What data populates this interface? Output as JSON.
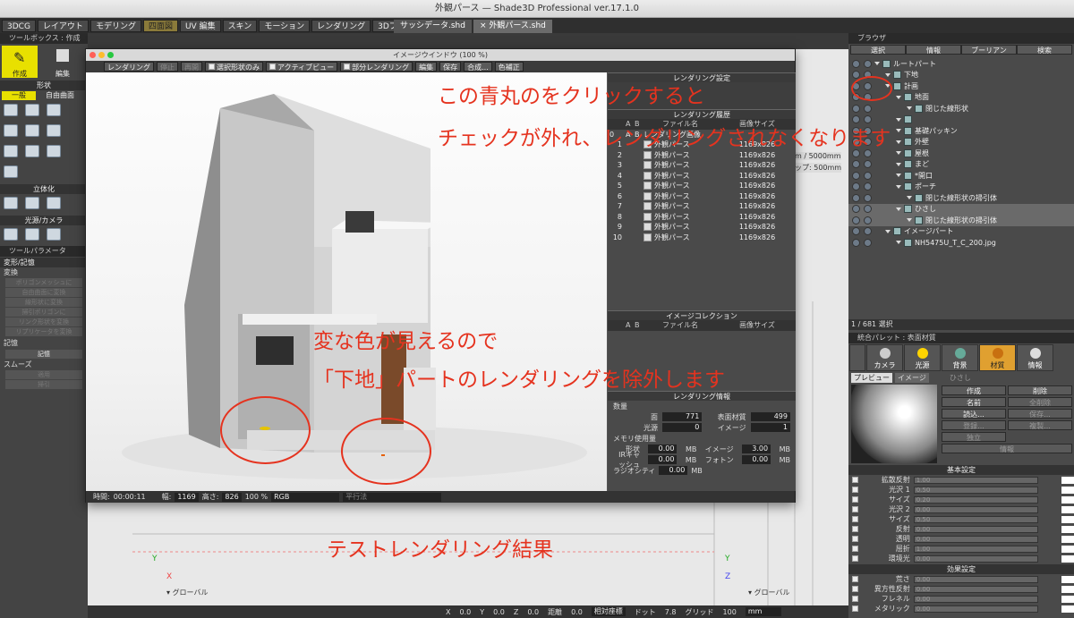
{
  "window": {
    "title": "外観パース — Shade3D Professional ver.17.1.0"
  },
  "workspace_tabs": [
    "3DCG",
    "レイアウト",
    "モデリング",
    "四面図",
    "UV 編集",
    "スキン",
    "モーション",
    "レンダリング",
    "3Dプリント",
    "＋ —"
  ],
  "doc_tabs": [
    "サッシデータ.shd",
    "× 外観パース.shd"
  ],
  "left": {
    "toolbox": "ツールボックス : 作成",
    "create": "作成",
    "edit": "編集",
    "shape": "形状",
    "general": "一般",
    "freeform": "自由曲面",
    "solid": "立体化",
    "lights": "光源/カメラ",
    "params": "ツールパラメータ",
    "transform_memory": "変形/記憶",
    "transform": "変換",
    "btns": [
      "ポリゴンメッシュに",
      "自由曲面に変換",
      "線形状に変換",
      "掃引ポリゴンに",
      "リンク形状を変換",
      "リプリケータを変換"
    ],
    "memory": "記憶",
    "mem_btn": "記憶",
    "smooth": "スムーズ",
    "apply": "適用",
    "sweep": "掃引"
  },
  "imgwin": {
    "title": "イメージウインドウ (100 %)",
    "toolbar": {
      "render": "レンダリング",
      "stop": "停止",
      "restart": "再開",
      "sel_only": "選択形状のみ",
      "active_view": "アクティブビュー",
      "partial": "部分レンダリング",
      "edit": "編集",
      "save": "保存",
      "composite": "合成...",
      "color": "色補正"
    },
    "status": {
      "time_label": "時間:",
      "time": "00:00:11",
      "width_label": "幅:",
      "width": "1169",
      "height_label": "高さ:",
      "height": "826",
      "zoom": "100 %",
      "mode": "RGB",
      "extra": "平行法"
    },
    "right": {
      "render_section": "レンダリング設定",
      "history_title": "レンダリング履歴",
      "history_headers": [
        "A",
        "B",
        "ファイル名",
        "画像サイズ"
      ],
      "history_top": "レンダリング画像",
      "history": [
        {
          "n": "1",
          "name": "外観パース",
          "size": "1169x826"
        },
        {
          "n": "2",
          "name": "外観パース",
          "size": "1169x826"
        },
        {
          "n": "3",
          "name": "外観パース",
          "size": "1169x826"
        },
        {
          "n": "4",
          "name": "外観パース",
          "size": "1169x826"
        },
        {
          "n": "5",
          "name": "外観パース",
          "size": "1169x826"
        },
        {
          "n": "6",
          "name": "外観パース",
          "size": "1169x826"
        },
        {
          "n": "7",
          "name": "外観パース",
          "size": "1169x826"
        },
        {
          "n": "8",
          "name": "外観パース",
          "size": "1169x826"
        },
        {
          "n": "9",
          "name": "外観パース",
          "size": "1169x826"
        },
        {
          "n": "10",
          "name": "外観パース",
          "size": "1169x826"
        }
      ],
      "collection_title": "イメージコレクション",
      "collection_headers": [
        "A",
        "B",
        "ファイル名",
        "画像サイズ"
      ],
      "info_title": "レンダリング情報",
      "count": "数量",
      "faces_l": "面",
      "faces": "771",
      "surf_l": "表面材質",
      "surf": "499",
      "lights_l": "光源",
      "lights": "0",
      "img_l": "イメージ",
      "img": "1",
      "mem": "メモリ使用量",
      "shape_l": "形状",
      "shape": "0.00",
      "image_l": "イメージ",
      "image": "3.00",
      "ir_l": "IRキャッシュ",
      "ir": "0.00",
      "photon_l": "フォトン",
      "photon": "0.00",
      "rad_l": "ラジオシティ",
      "rad": "0.00",
      "unit": "MB"
    }
  },
  "browser": {
    "title": "ブラウザ",
    "tabs": [
      "選択",
      "情報",
      "ブーリアン",
      "検索"
    ],
    "tree": [
      {
        "label": "ルートパート",
        "d": 0
      },
      {
        "label": "下地",
        "d": 1
      },
      {
        "label": "計画",
        "d": 1
      },
      {
        "label": "地面",
        "d": 2
      },
      {
        "label": "閉じた線形状",
        "d": 3
      },
      {
        "label": "",
        "d": 2
      },
      {
        "label": "基礎パッキン",
        "d": 2
      },
      {
        "label": "外壁",
        "d": 2
      },
      {
        "label": "屋根",
        "d": 2
      },
      {
        "label": "まど",
        "d": 2
      },
      {
        "label": "*開口",
        "d": 2
      },
      {
        "label": "ポーチ",
        "d": 2
      },
      {
        "label": "閉じた線形状の掃引体",
        "d": 3
      },
      {
        "label": "ひさし",
        "d": 2
      },
      {
        "label": "閉じた線形状の掃引体",
        "d": 3
      },
      {
        "label": "イメージパート",
        "d": 1
      },
      {
        "label": "NH5475U_T_C_200.jpg",
        "d": 2
      }
    ],
    "count": "1 / 681 選択"
  },
  "integrated": {
    "title": "統合パレット : 表面材質",
    "tabs": [
      "カメラ",
      "光源",
      "背景",
      "材質",
      "情報"
    ],
    "preview": "プレビュー",
    "image": "イメージ",
    "hisashi": "ひさし",
    "buttons": [
      "作成",
      "削除",
      "名前",
      "全削除",
      "読込...",
      "保存...",
      "登録...",
      "複製...",
      "独立",
      "情報"
    ],
    "basic": "基本設定",
    "props": [
      {
        "l": "拡散反射",
        "v": "1.00"
      },
      {
        "l": "光沢 1",
        "v": "0.50"
      },
      {
        "l": "サイズ",
        "v": "0.20"
      },
      {
        "l": "光沢 2",
        "v": "0.00"
      },
      {
        "l": "サイズ",
        "v": "0.50"
      },
      {
        "l": "反射",
        "v": "0.00"
      },
      {
        "l": "透明",
        "v": "0.00"
      },
      {
        "l": "屈折",
        "v": "1.00"
      },
      {
        "l": "環境光",
        "v": "0.00"
      }
    ],
    "effects": "効果設定",
    "effprops": [
      {
        "l": "荒さ",
        "v": "0.00"
      },
      {
        "l": "異方性反射",
        "v": "0.00"
      },
      {
        "l": "フレネル",
        "v": "0.00"
      },
      {
        "l": "メタリック",
        "v": "0.00"
      }
    ]
  },
  "viewport": {
    "global": "グローバル",
    "scale1": "m / 5000mm",
    "scale2": "ップ: 500mm"
  },
  "coords": {
    "x_l": "X",
    "x": "0.0",
    "y_l": "Y",
    "y": "0.0",
    "z_l": "Z",
    "z": "0.0",
    "dist_l": "距離",
    "dist": "0.0",
    "rel": "相対座標",
    "dot_l": "ドット",
    "dot": "7.8",
    "grid_l": "グリッド",
    "grid": "100",
    "unit": "mm"
  },
  "annotations": {
    "a1": "この青丸のをクリックすると",
    "a2": "チェックが外れ、レンダリングされなくなります",
    "a3": "変な色が見えるので",
    "a4": "「下地」パートのレンダリングを除外します",
    "a5": "テストレンダリング結果"
  },
  "colors": {
    "annotation": "#e5331f",
    "accent": "#e0a030"
  }
}
